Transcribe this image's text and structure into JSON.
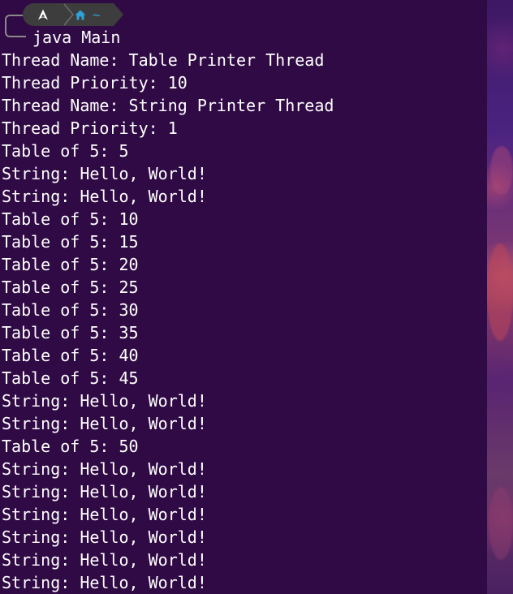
{
  "prompt": {
    "os_icon": "arch-linux-icon",
    "path_icon": "home-icon",
    "path_text": "~",
    "separator_icon": "chevron-right-icon"
  },
  "command": "java Main",
  "output_lines": [
    "Thread Name: Table Printer Thread",
    "Thread Priority: 10",
    "Thread Name: String Printer Thread",
    "Thread Priority: 1",
    "Table of 5: 5",
    "String: Hello, World!",
    "String: Hello, World!",
    "Table of 5: 10",
    "Table of 5: 15",
    "Table of 5: 20",
    "Table of 5: 25",
    "Table of 5: 30",
    "Table of 5: 35",
    "Table of 5: 40",
    "Table of 5: 45",
    "String: Hello, World!",
    "String: Hello, World!",
    "Table of 5: 50",
    "String: Hello, World!",
    "String: Hello, World!",
    "String: Hello, World!",
    "String: Hello, World!",
    "String: Hello, World!",
    "String: Hello, World!"
  ],
  "colors": {
    "background": "#300a45",
    "text": "#ffffff",
    "prompt_segment": "#3d3d3d",
    "path_accent": "#2ea3d8",
    "bracket": "#8a8a8a"
  }
}
